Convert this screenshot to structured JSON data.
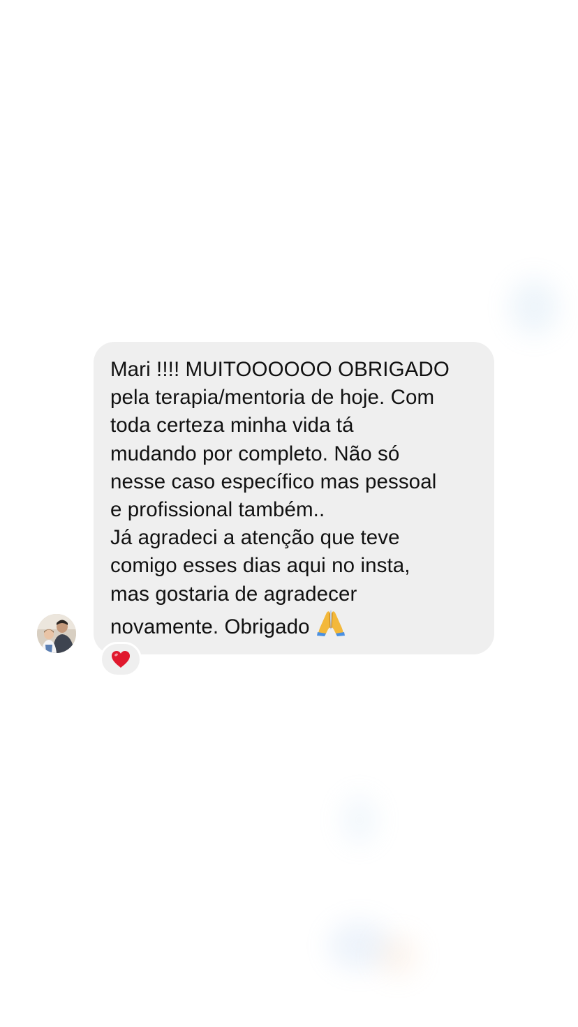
{
  "conversation": {
    "message": {
      "lines": [
        "Mari !!!! MUITOOOOOO OBRIGADO",
        "pela terapia/mentoria de hoje. Com",
        "toda certeza minha vida tá",
        "mudando por completo. Não só",
        "nesse caso específico mas pessoal",
        "e profissional também..",
        "Já agradeci a atenção que teve",
        "comigo esses dias aqui no insta,",
        "mas gostaria de agradecer",
        "novamente. Obrigado"
      ],
      "trailing_emoji": "folded-hands-icon",
      "reaction": "heart-icon"
    },
    "sender": {
      "avatar": "avatar-photo"
    },
    "colors": {
      "bubble": "#efefef",
      "text": "#111111",
      "background": "#ffffff",
      "heart": "#e0182d"
    }
  }
}
